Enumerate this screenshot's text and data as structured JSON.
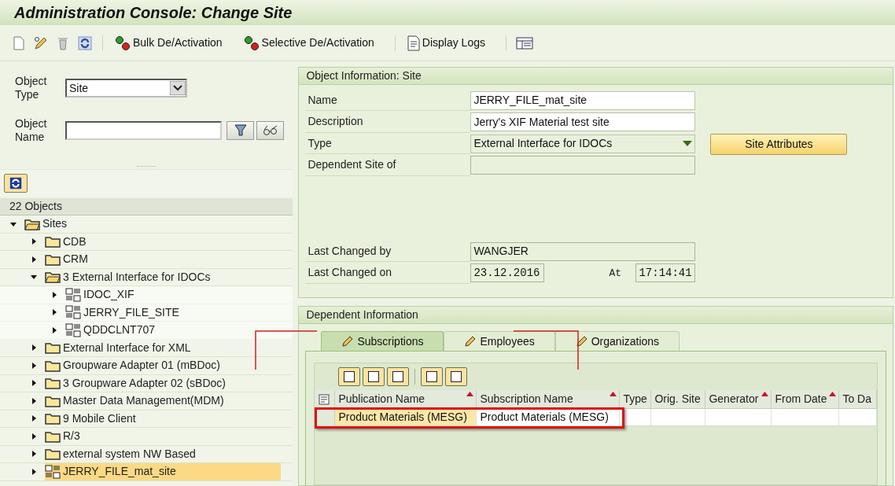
{
  "window": {
    "title": "Administration Console: Change Site"
  },
  "toolbar": [
    {
      "kind": "icon"
    },
    {
      "kind": "icon"
    },
    {
      "kind": "icon"
    },
    {
      "kind": "icon"
    },
    {
      "kind": "separator"
    },
    {
      "kind": "button",
      "label": "Bulk De/Activation"
    },
    {
      "kind": "button",
      "label": "Selective De/Activation"
    },
    {
      "kind": "separator"
    },
    {
      "kind": "button",
      "label": "Display Logs"
    },
    {
      "kind": "separator"
    },
    {
      "kind": "icon"
    }
  ],
  "search": {
    "object_type": {
      "label": "Object Type",
      "value": "Site"
    },
    "object_name": {
      "label": "Object Name"
    }
  },
  "tree": {
    "count": "22 Objects",
    "items": [
      {
        "label": "Sites",
        "kind": "folder",
        "expanded": true,
        "selected": false,
        "children": [
          {
            "label": "CDB",
            "kind": "folder",
            "expanded": false,
            "selected": false
          },
          {
            "label": "CRM",
            "kind": "folder",
            "expanded": false,
            "selected": false
          },
          {
            "label": "3 External Interface for IDOCs",
            "kind": "folder",
            "expanded": true,
            "selected": false,
            "children": [
              {
                "label": "IDOC_XIF",
                "kind": "site",
                "expanded": false,
                "selected": false
              },
              {
                "label": "JERRY_FILE_SITE",
                "kind": "site",
                "expanded": false,
                "selected": false
              },
              {
                "label": "QDDCLNT707",
                "kind": "site",
                "expanded": false,
                "selected": false
              }
            ]
          },
          {
            "label": "External Interface for XML",
            "kind": "folder",
            "expanded": false,
            "selected": false
          },
          {
            "label": "Groupware Adapter 01 (mBDoc)",
            "kind": "folder",
            "expanded": false,
            "selected": false
          },
          {
            "label": "3 Groupware Adapter 02 (sBDoc)",
            "kind": "folder",
            "expanded": false,
            "selected": false
          },
          {
            "label": "Master Data Management(MDM)",
            "kind": "folder",
            "expanded": false,
            "selected": false
          },
          {
            "label": "9 Mobile Client",
            "kind": "folder",
            "expanded": false,
            "selected": false
          },
          {
            "label": "R/3",
            "kind": "folder",
            "expanded": false,
            "selected": false
          },
          {
            "label": "external system NW Based",
            "kind": "folder",
            "expanded": false,
            "selected": false
          },
          {
            "label": "JERRY_FILE_mat_site",
            "kind": "site",
            "expanded": false,
            "selected": true
          }
        ]
      }
    ]
  },
  "object_information": {
    "title": "Object Information: Site",
    "button": "Site Attributes",
    "fields": [
      {
        "label": "Name",
        "kind": "input",
        "value": "JERRY_FILE_mat_site"
      },
      {
        "label": "Description",
        "kind": "input",
        "value": "Jerry's XIF Material test site"
      },
      {
        "label": "Type",
        "kind": "dropdown",
        "value": "External Interface for IDOCs"
      },
      {
        "label": "Dependent Site of",
        "kind": "readonly"
      },
      {
        "label": "Last Changed by",
        "kind": "readonly",
        "value": "WANGJER"
      },
      {
        "label": "Last Changed on",
        "kind": "date",
        "value": "23.12.2016",
        "at_label": "At",
        "time": "17:14:41"
      }
    ]
  },
  "dependent_information": {
    "title": "Dependent Information",
    "tabs": [
      {
        "label": "Subscriptions",
        "selected": true
      },
      {
        "label": "Employees",
        "selected": false
      },
      {
        "label": "Organizations",
        "selected": false
      }
    ],
    "table": {
      "columns": [
        {
          "label": "Publication Name",
          "sorted": true
        },
        {
          "label": "Subscription Name",
          "sorted": true
        },
        {
          "label": "Type",
          "sorted": false
        },
        {
          "label": "Orig. Site",
          "sorted": false
        },
        {
          "label": "Generator",
          "sorted": true
        },
        {
          "label": "From Date",
          "sorted": true
        },
        {
          "label": "To Da",
          "sorted": false
        }
      ],
      "rows": [
        {
          "cells": [
            {
              "text": "Product Materials (MESG)",
              "highlighted": true
            },
            {
              "text": "Product Materials (MESG)",
              "highlighted": false
            }
          ],
          "marked": true
        }
      ]
    }
  }
}
